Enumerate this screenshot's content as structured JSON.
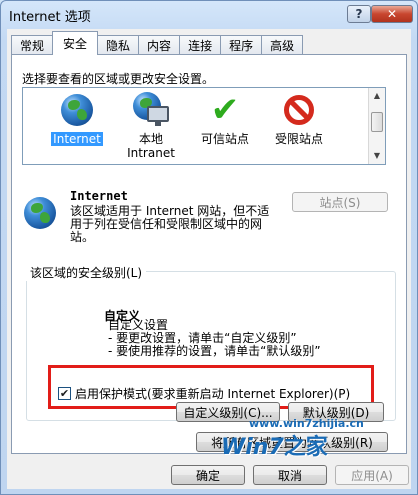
{
  "window": {
    "title": "Internet 选项",
    "help_glyph": "?",
    "close_glyph": "✕"
  },
  "tabs": [
    {
      "label": "常规"
    },
    {
      "label": "安全"
    },
    {
      "label": "隐私"
    },
    {
      "label": "内容"
    },
    {
      "label": "连接"
    },
    {
      "label": "程序"
    },
    {
      "label": "高级"
    }
  ],
  "security": {
    "select_label": "选择要查看的区域或更改安全设置。",
    "zones": [
      {
        "label": "Internet",
        "icon": "globe-icon"
      },
      {
        "label": "本地",
        "label2": "Intranet",
        "icon": "local-intranet-icon"
      },
      {
        "label": "可信站点",
        "icon": "checkmark-icon"
      },
      {
        "label": "受限站点",
        "icon": "no-entry-icon"
      }
    ],
    "zone_info": {
      "title": "Internet",
      "desc": "该区域适用于 Internet 网站，但不适用于列在受信任和受限制区域中的网站。",
      "sites_button": "站点(S)"
    },
    "level_group_label": "该区域的安全级别(L)",
    "level": {
      "name": "自定义",
      "lines": [
        "自定义设置",
        "- 要更改设置，请单击“自定义级别”",
        "- 要使用推荐的设置，请单击“默认级别”"
      ]
    },
    "protected_mode": {
      "label": "启用保护模式(要求重新启动 Internet Explorer)(P)",
      "checked": true
    },
    "custom_level_button": "自定义级别(C)...",
    "default_level_button": "默认级别(D)",
    "reset_all_button": "将所有区域重置为默认级别(R)"
  },
  "footer": {
    "ok": "确定",
    "cancel": "取消",
    "apply": "应用(A)"
  },
  "watermark": {
    "brand": "Win7",
    "url": "www.win7zhijia.cn",
    "suffix": "之家"
  },
  "colors": {
    "selection": "#3399ff",
    "highlight_box": "#e21d18"
  }
}
